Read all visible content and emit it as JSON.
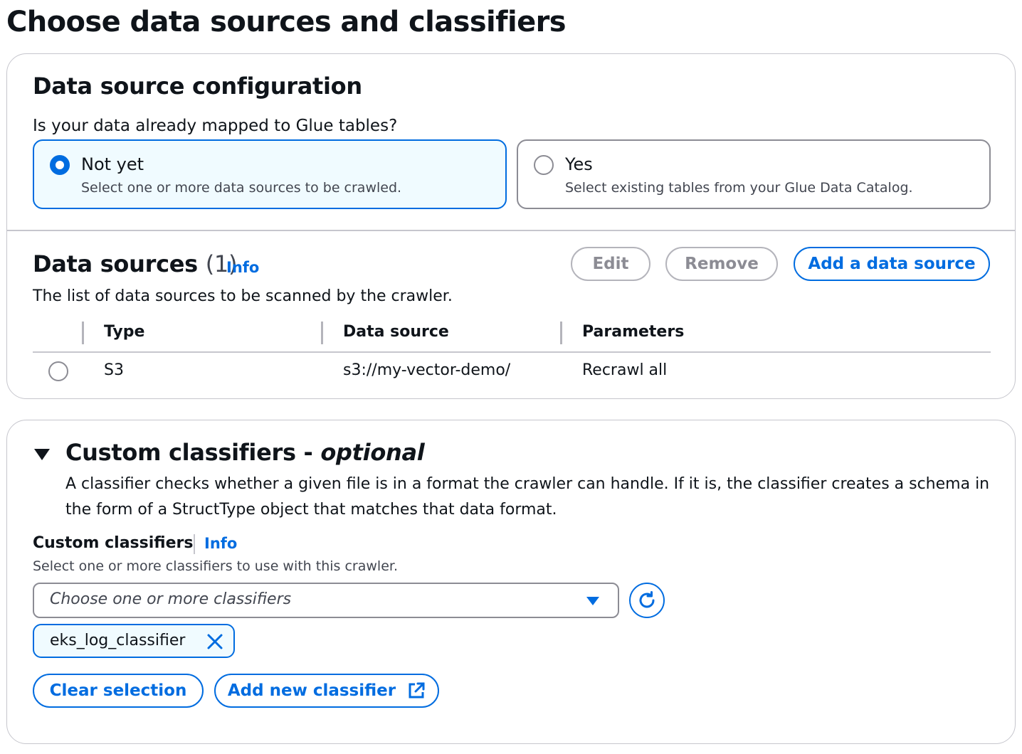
{
  "page": {
    "title": "Choose data sources and classifiers"
  },
  "config": {
    "heading": "Data source configuration",
    "question": "Is your data already mapped to Glue tables?",
    "options": [
      {
        "label": "Not yet",
        "description": "Select one or more data sources to be crawled.",
        "selected": true
      },
      {
        "label": "Yes",
        "description": "Select existing tables from your Glue Data Catalog.",
        "selected": false
      }
    ]
  },
  "data_sources": {
    "heading": "Data sources",
    "count": "(1)",
    "info": "Info",
    "description": "The list of data sources to be scanned by the crawler.",
    "buttons": {
      "edit": "Edit",
      "remove": "Remove",
      "add": "Add a data source"
    },
    "columns": [
      "Type",
      "Data source",
      "Parameters"
    ],
    "rows": [
      {
        "type": "S3",
        "source": "s3://my-vector-demo/",
        "parameters": "Recrawl all"
      }
    ]
  },
  "classifiers": {
    "heading": "Custom classifiers - ",
    "heading_optional": "optional",
    "description": "A classifier checks whether a given file is in a format the crawler can handle. If it is, the classifier creates a schema in the form of a StructType object that matches that data format.",
    "field_label": "Custom classifiers",
    "info": "Info",
    "field_description": "Select one or more classifiers to use with this crawler.",
    "placeholder": "Choose one or more classifiers",
    "selected_tokens": [
      "eks_log_classifier"
    ],
    "buttons": {
      "clear": "Clear selection",
      "add_new": "Add new classifier"
    }
  }
}
